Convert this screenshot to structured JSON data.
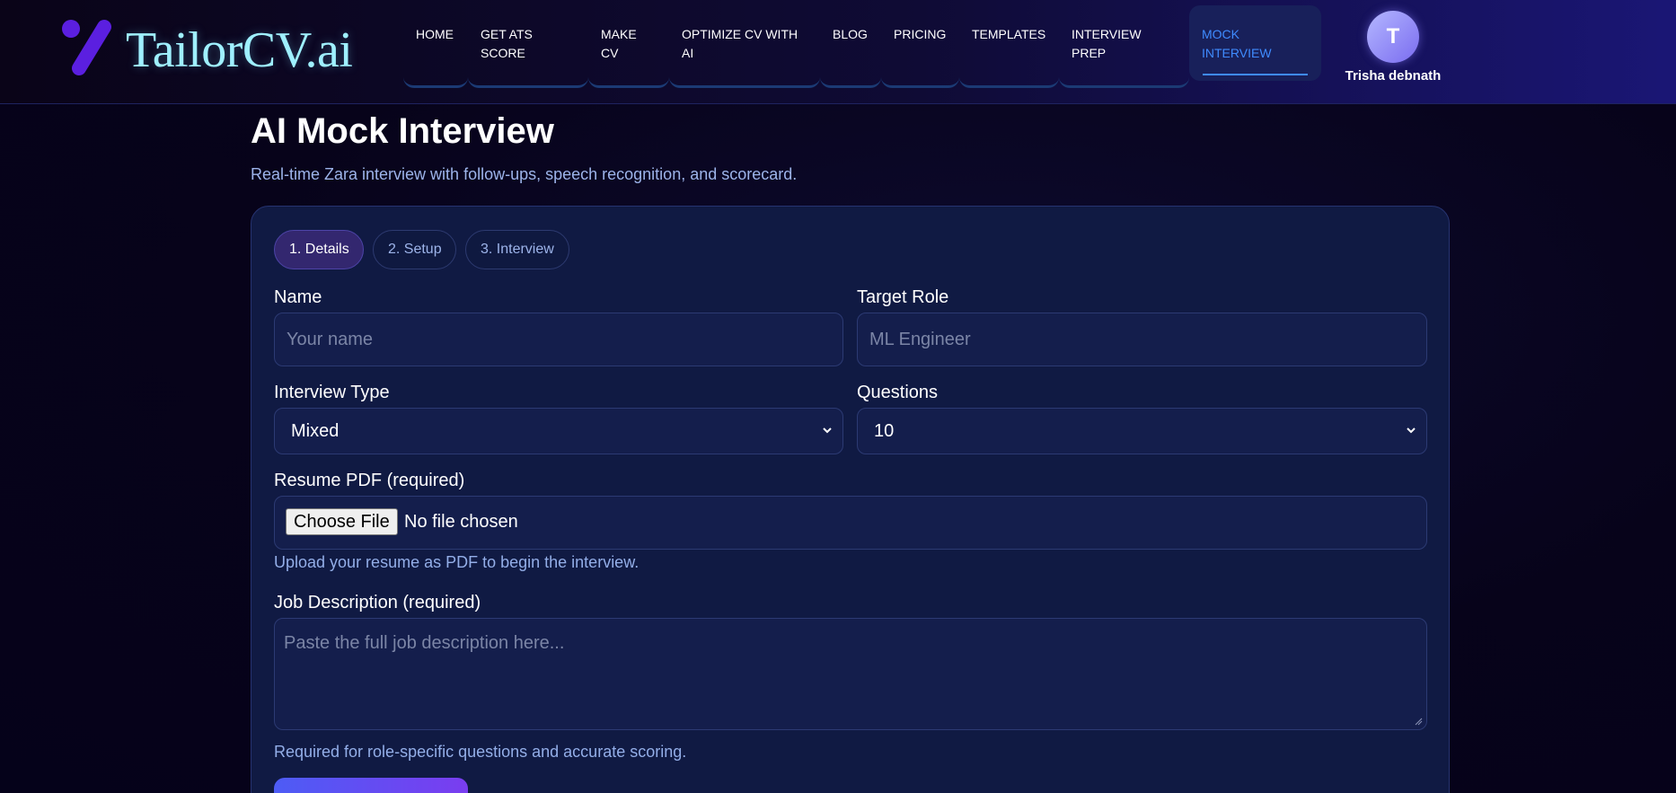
{
  "brand": {
    "name": "TailorCV.ai"
  },
  "nav": {
    "items": [
      {
        "label": "HOME"
      },
      {
        "label": "GET ATS SCORE"
      },
      {
        "label": "MAKE CV"
      },
      {
        "label": "OPTIMIZE CV WITH AI"
      },
      {
        "label": "BLOG"
      },
      {
        "label": "PRICING"
      },
      {
        "label": "TEMPLATES"
      },
      {
        "label": "INTERVIEW PREP"
      },
      {
        "label": "MOCK INTERVIEW"
      }
    ],
    "active": "MOCK INTERVIEW"
  },
  "user": {
    "initial": "T",
    "name": "Trisha debnath"
  },
  "page": {
    "title": "AI Mock Interview",
    "subtitle": "Real-time Zara interview with follow-ups, speech recognition, and scorecard."
  },
  "steps": [
    {
      "label": "1. Details",
      "active": true
    },
    {
      "label": "2. Setup",
      "active": false
    },
    {
      "label": "3. Interview",
      "active": false
    }
  ],
  "form": {
    "name": {
      "label": "Name",
      "placeholder": "Your name",
      "value": ""
    },
    "target_role": {
      "label": "Target Role",
      "placeholder": "ML Engineer",
      "value": ""
    },
    "interview_type": {
      "label": "Interview Type",
      "selected": "Mixed"
    },
    "questions": {
      "label": "Questions",
      "selected": "10"
    },
    "resume": {
      "label": "Resume PDF (required)",
      "button_label": "Choose File",
      "status": "No file chosen",
      "hint": "Upload your resume as PDF to begin the interview."
    },
    "job_description": {
      "label": "Job Description (required)",
      "placeholder": "Paste the full job description here...",
      "hint": "Required for role-specific questions and accurate scoring."
    }
  },
  "icons": {
    "logo": "slash-logo-icon",
    "dropdown": "chevron-down-icon",
    "resize": "resize-handle-icon"
  },
  "colors": {
    "accent": "#3f8bff",
    "logo_text": "#9ff0ff",
    "logo_mark": "#5b1fe0",
    "card_bg": "#101a43",
    "button_gradient_start": "#4d5cf5",
    "button_gradient_end": "#7a3df0"
  }
}
